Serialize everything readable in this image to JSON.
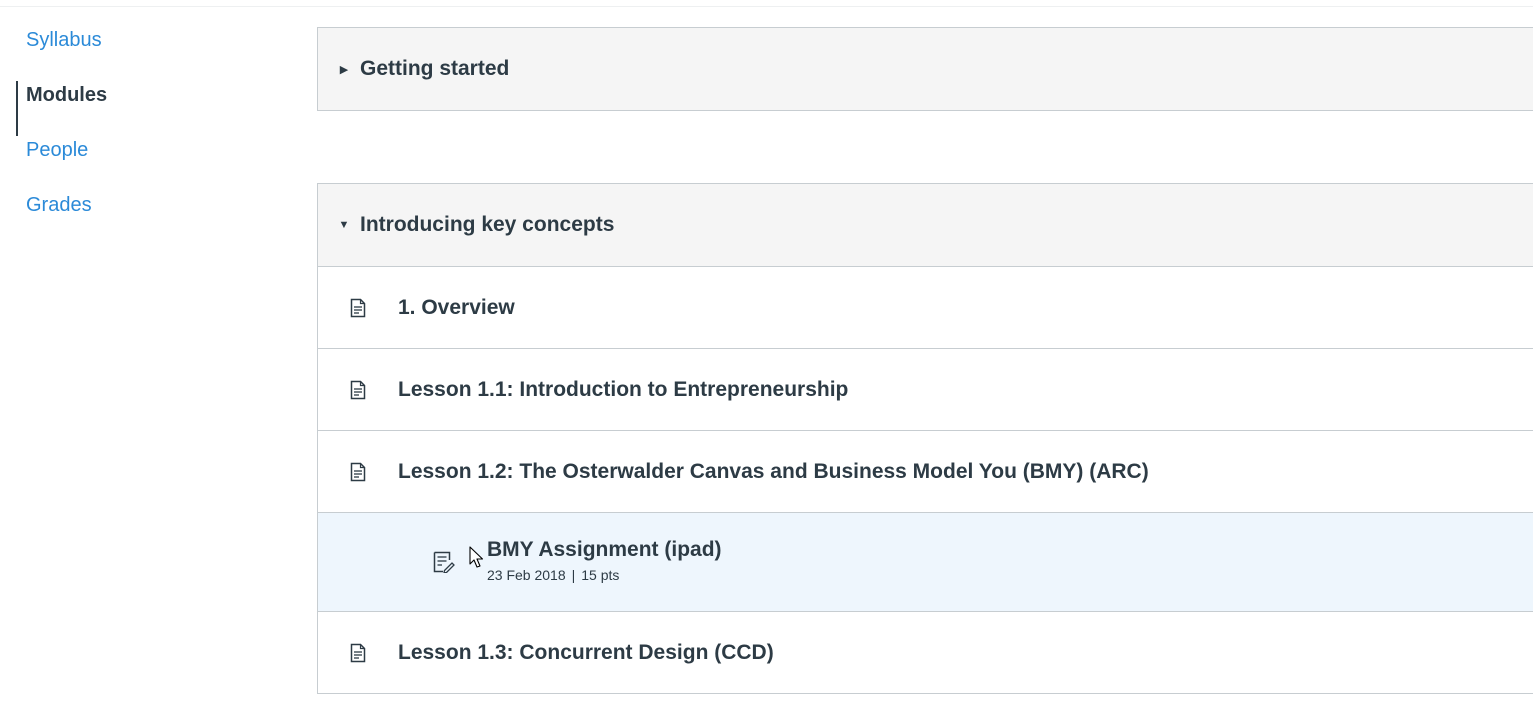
{
  "course_nav": {
    "items": [
      {
        "label": "Syllabus",
        "active": false
      },
      {
        "label": "Modules",
        "active": true
      },
      {
        "label": "People",
        "active": false
      },
      {
        "label": "Grades",
        "active": false
      }
    ]
  },
  "modules": [
    {
      "title": "Getting started",
      "expanded": false,
      "caret_icon": "caret-right-icon"
    },
    {
      "title": "Introducing key concepts",
      "expanded": true,
      "caret_icon": "caret-down-icon",
      "items": [
        {
          "title": "1. Overview",
          "icon": "page-icon"
        },
        {
          "title": "Lesson 1.1: Introduction to Entrepreneurship",
          "icon": "page-icon"
        },
        {
          "title": "Lesson 1.2: The Osterwalder Canvas and Business Model You (BMY) (ARC)",
          "icon": "page-icon"
        },
        {
          "title": "BMY Assignment (ipad)",
          "icon": "assignment-icon",
          "date": "23 Feb 2018",
          "separator": "|",
          "points": "15 pts"
        },
        {
          "title": "Lesson 1.3: Concurrent Design (CCD)",
          "icon": "page-icon"
        }
      ]
    }
  ],
  "colors": {
    "link": "#2b8ad8",
    "text": "#2d3b45",
    "header_bg": "#f5f5f5",
    "highlight_bg": "#eef6fd",
    "border": "#c7cdd1"
  }
}
